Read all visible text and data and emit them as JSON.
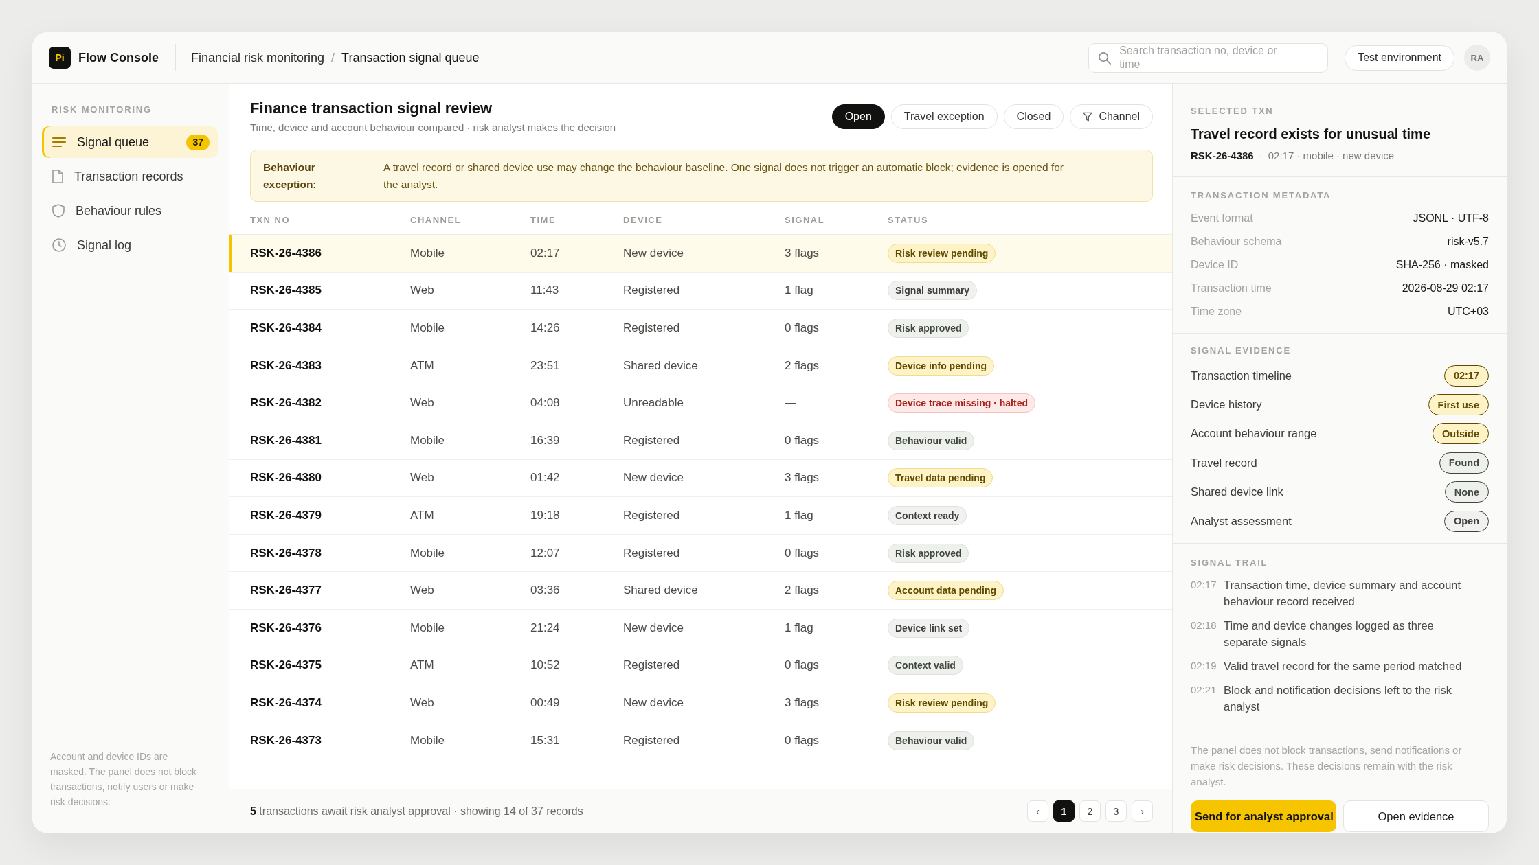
{
  "header": {
    "logo": "Pi",
    "app_name": "Flow Console",
    "breadcrumb": {
      "items": [
        "Financial risk monitoring",
        "Transaction signal queue"
      ],
      "separator": "/"
    },
    "search": {
      "placeholder": "Search transaction no, device or time"
    },
    "environment": "Test environment",
    "avatar": "RA"
  },
  "sidebar": {
    "section_title": "RISK MONITORING",
    "items": [
      {
        "label": "Signal queue",
        "badge": "37",
        "selected": true
      },
      {
        "label": "Transaction records",
        "selected": false
      },
      {
        "label": "Behaviour rules",
        "selected": false
      },
      {
        "label": "Signal log",
        "selected": false
      }
    ],
    "note": "Account and device IDs are masked. The panel does not block transactions, notify users or make risk decisions."
  },
  "main": {
    "title": "Finance transaction signal review",
    "subtitle": "Time, device and account behaviour compared · risk analyst makes the decision",
    "filters": [
      {
        "label": "Open",
        "kind": "status",
        "selected": true
      },
      {
        "label": "Travel exception",
        "kind": "status",
        "selected": false
      },
      {
        "label": "Closed",
        "kind": "status",
        "selected": false
      },
      {
        "label": "Channel",
        "kind": "filter",
        "selected": false
      }
    ],
    "notice": {
      "label": "Behaviour exception:",
      "text": "A travel record or shared device use may change the behaviour baseline. One signal does not trigger an automatic block; evidence is opened for the analyst."
    }
  },
  "table": {
    "columns": [
      "TXN NO",
      "CHANNEL",
      "TIME",
      "DEVICE",
      "SIGNAL",
      "STATUS"
    ],
    "rows": [
      {
        "txn_no": "RSK-26-4386",
        "channel": "Mobile",
        "time": "02:17",
        "device": "New device",
        "signal": "3 flags",
        "status": {
          "label": "Risk review pending",
          "kind": "pending"
        },
        "selected": true
      },
      {
        "txn_no": "RSK-26-4385",
        "channel": "Web",
        "time": "11:43",
        "device": "Registered",
        "signal": "1 flag",
        "status": {
          "label": "Signal summary",
          "kind": "neutral"
        },
        "selected": false
      },
      {
        "txn_no": "RSK-26-4384",
        "channel": "Mobile",
        "time": "14:26",
        "device": "Registered",
        "signal": "0 flags",
        "status": {
          "label": "Risk approved",
          "kind": "approved"
        },
        "selected": false
      },
      {
        "txn_no": "RSK-26-4383",
        "channel": "ATM",
        "time": "23:51",
        "device": "Shared device",
        "signal": "2 flags",
        "status": {
          "label": "Device info pending",
          "kind": "pending"
        },
        "selected": false
      },
      {
        "txn_no": "RSK-26-4382",
        "channel": "Web",
        "time": "04:08",
        "device": "Unreadable",
        "signal": "—",
        "status": {
          "label": "Device trace missing · halted",
          "kind": "halted"
        },
        "selected": false
      },
      {
        "txn_no": "RSK-26-4381",
        "channel": "Mobile",
        "time": "16:39",
        "device": "Registered",
        "signal": "0 flags",
        "status": {
          "label": "Behaviour valid",
          "kind": "approved"
        },
        "selected": false
      },
      {
        "txn_no": "RSK-26-4380",
        "channel": "Web",
        "time": "01:42",
        "device": "New device",
        "signal": "3 flags",
        "status": {
          "label": "Travel data pending",
          "kind": "pending"
        },
        "selected": false
      },
      {
        "txn_no": "RSK-26-4379",
        "channel": "ATM",
        "time": "19:18",
        "device": "Registered",
        "signal": "1 flag",
        "status": {
          "label": "Context ready",
          "kind": "neutral"
        },
        "selected": false
      },
      {
        "txn_no": "RSK-26-4378",
        "channel": "Mobile",
        "time": "12:07",
        "device": "Registered",
        "signal": "0 flags",
        "status": {
          "label": "Risk approved",
          "kind": "approved"
        },
        "selected": false
      },
      {
        "txn_no": "RSK-26-4377",
        "channel": "Web",
        "time": "03:36",
        "device": "Shared device",
        "signal": "2 flags",
        "status": {
          "label": "Account data pending",
          "kind": "pending"
        },
        "selected": false
      },
      {
        "txn_no": "RSK-26-4376",
        "channel": "Mobile",
        "time": "21:24",
        "device": "New device",
        "signal": "1 flag",
        "status": {
          "label": "Device link set",
          "kind": "neutral"
        },
        "selected": false
      },
      {
        "txn_no": "RSK-26-4375",
        "channel": "ATM",
        "time": "10:52",
        "device": "Registered",
        "signal": "0 flags",
        "status": {
          "label": "Context valid",
          "kind": "approved"
        },
        "selected": false
      },
      {
        "txn_no": "RSK-26-4374",
        "channel": "Web",
        "time": "00:49",
        "device": "New device",
        "signal": "3 flags",
        "status": {
          "label": "Risk review pending",
          "kind": "pending"
        },
        "selected": false
      },
      {
        "txn_no": "RSK-26-4373",
        "channel": "Mobile",
        "time": "15:31",
        "device": "Registered",
        "signal": "0 flags",
        "status": {
          "label": "Behaviour valid",
          "kind": "approved"
        },
        "selected": false
      }
    ]
  },
  "table_footer": {
    "summary": "**5** transactions await risk analyst approval · showing 14 of 37 records",
    "pagination": {
      "prev": "‹",
      "pages": [
        {
          "label": "1",
          "selected": true
        },
        {
          "label": "2",
          "selected": false
        },
        {
          "label": "3",
          "selected": false
        }
      ],
      "next": "›"
    }
  },
  "detail": {
    "selected": {
      "eyebrow": "SELECTED TXN",
      "title": "Travel record exists for unusual time",
      "txn_no": "RSK-26-4386",
      "separator": "·",
      "meta": "02:17 · mobile · new device"
    },
    "metadata": {
      "title": "TRANSACTION METADATA",
      "rows": [
        {
          "label": "Event format",
          "value": "JSONL · UTF-8"
        },
        {
          "label": "Behaviour schema",
          "value": "risk-v5.7"
        },
        {
          "label": "Device ID",
          "value": "SHA-256 · masked"
        },
        {
          "label": "Transaction time",
          "value": "2026-08-29 02:17"
        },
        {
          "label": "Time zone",
          "value": "UTC+03"
        }
      ]
    },
    "evidence": {
      "title": "SIGNAL EVIDENCE",
      "rows": [
        {
          "label": "Transaction timeline",
          "value": "02:17",
          "kind": "pending"
        },
        {
          "label": "Device history",
          "value": "First use",
          "kind": "pending"
        },
        {
          "label": "Account behaviour range",
          "value": "Outside",
          "kind": "pending"
        },
        {
          "label": "Travel record",
          "value": "Found",
          "kind": "approved"
        },
        {
          "label": "Shared device link",
          "value": "None",
          "kind": "approved"
        },
        {
          "label": "Analyst assessment",
          "value": "Open",
          "kind": "neutral"
        }
      ]
    },
    "trail": {
      "title": "SIGNAL TRAIL",
      "items": [
        {
          "time": "02:17",
          "text": "Transaction time, device summary and account behaviour record received"
        },
        {
          "time": "02:18",
          "text": "Time and device changes logged as three separate signals"
        },
        {
          "time": "02:19",
          "text": "Valid travel record for the same period matched"
        },
        {
          "time": "02:21",
          "text": "Block and notification decisions left to the risk analyst"
        }
      ]
    },
    "note": "The panel does not block transactions, send notifications or make risk decisions. These decisions remain with the risk analyst.",
    "actions": [
      {
        "label": "Send for analyst approval",
        "kind": "primary"
      },
      {
        "label": "Open evidence",
        "kind": "secondary"
      }
    ]
  }
}
